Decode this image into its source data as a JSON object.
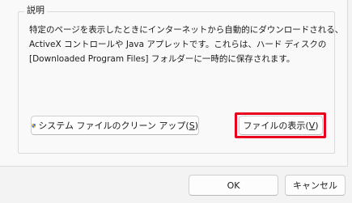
{
  "group": {
    "title": "説明",
    "description_lines": [
      "特定のページを表示したときにインターネットから自動的にダウンロードされる、",
      "ActiveX コントロールや Java アプレットです。これらは、ハード ディスクの",
      "[Downloaded Program Files] フォルダーに一時的に保存されます。"
    ]
  },
  "buttons": {
    "cleanup": {
      "label": "システム ファイルのクリーン アップ(",
      "accel": "S",
      "suffix": ")",
      "icon": "uac-shield-icon"
    },
    "view_files": {
      "label": "ファイルの表示(",
      "accel": "V",
      "suffix": ")"
    },
    "ok": {
      "label": "OK"
    },
    "cancel": {
      "label": "キャンセル"
    }
  },
  "colors": {
    "highlight_border": "#e8001c",
    "shield_blue": "#2f6fd6",
    "shield_yellow": "#f2c230"
  }
}
